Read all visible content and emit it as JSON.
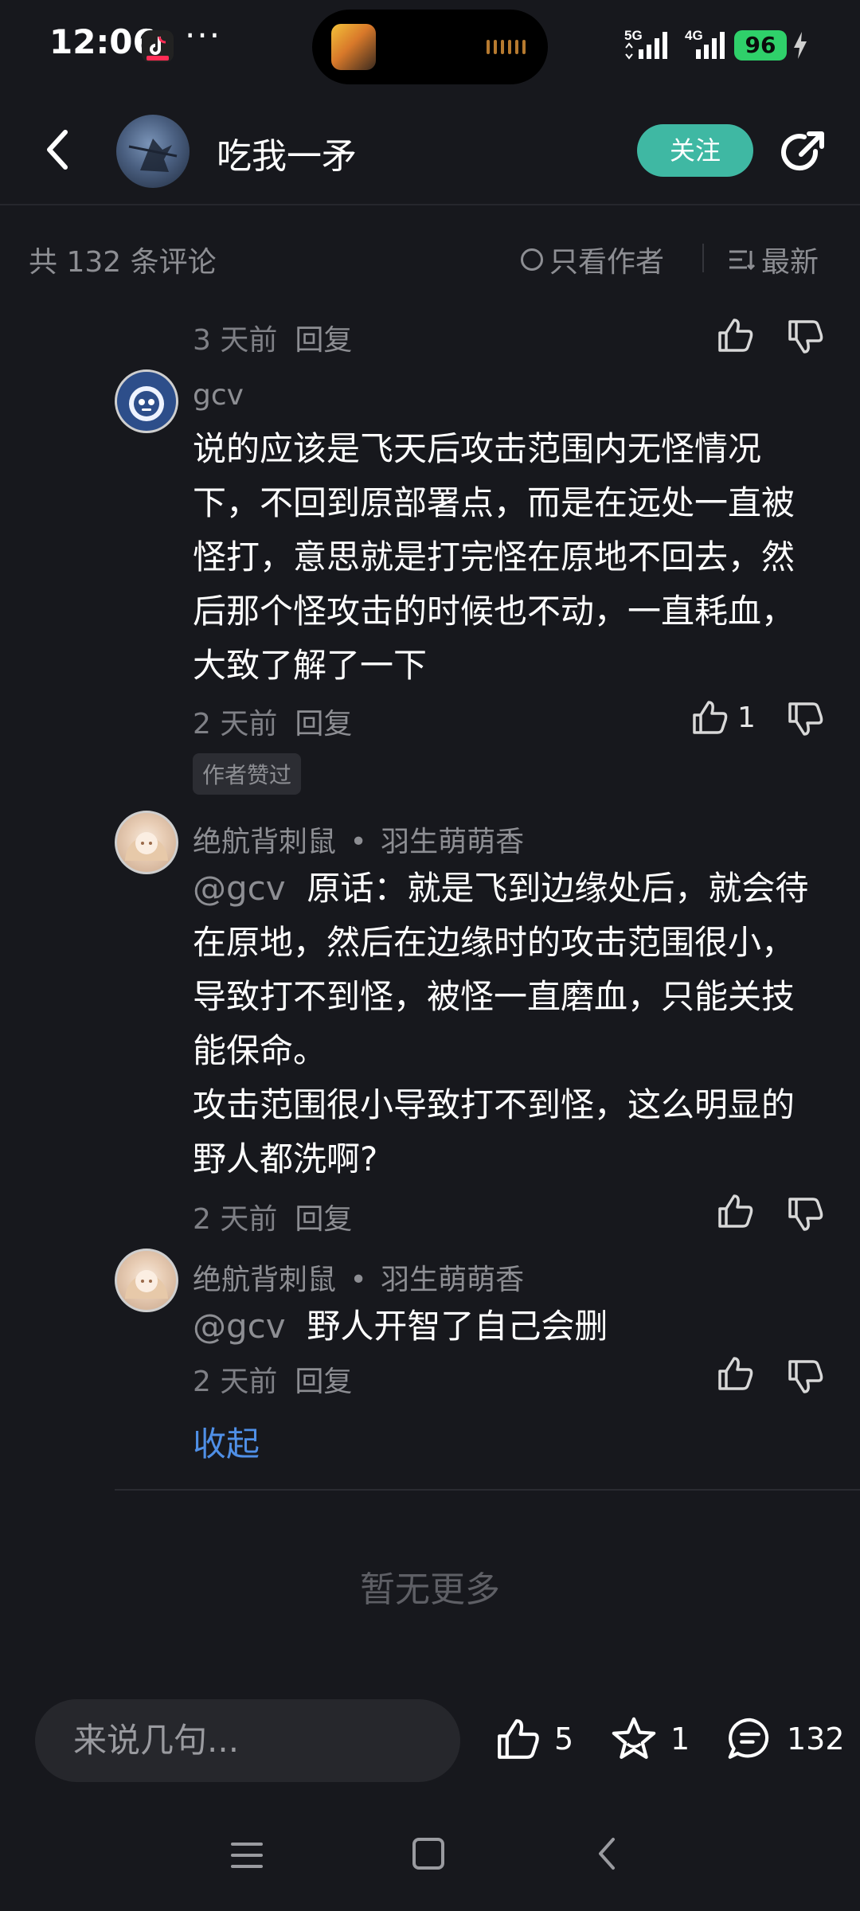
{
  "status_bar": {
    "time": "12:06",
    "more": "···",
    "net1": "5G",
    "net2": "4G",
    "battery": "96"
  },
  "header": {
    "author_name": "吃我一矛",
    "follow_label": "关注",
    "icons": [
      "back-icon",
      "share-icon"
    ]
  },
  "filters": {
    "comment_count": "共 132 条评论",
    "only_author": "只看作者",
    "sort_label": "最新"
  },
  "comments": [
    {
      "time": "3 天前",
      "reply_label": "回复"
    },
    {
      "user": "gcv",
      "text": "说的应该是飞天后攻击范围内无怪情况下，不回到原部署点，而是在远处一直被怪打，意思就是打完怪在原地不回去，然后那个怪攻击的时候也不动，一直耗血，大致了解了一下",
      "time": "2 天前",
      "reply_label": "回复",
      "likes": "1",
      "badge": "作者赞过"
    },
    {
      "user": "绝航背刺鼠",
      "reply_to": "羽生萌萌香",
      "mention": "@gcv",
      "text": "原话：就是飞到边缘处后，就会待在原地，然后在边缘时的攻击范围很小，导致打不到怪，被怪一直磨血，只能关技能保命。",
      "text2": "攻击范围很小导致打不到怪，这么明显的野人都洗啊?",
      "time": "2 天前",
      "reply_label": "回复"
    },
    {
      "user": "绝航背刺鼠",
      "reply_to": "羽生萌萌香",
      "mention": "@gcv",
      "text": "野人开智了自己会删",
      "time": "2 天前",
      "reply_label": "回复"
    }
  ],
  "collapse_label": "收起",
  "no_more": "暂无更多",
  "bottom_bar": {
    "input_placeholder": "来说几句...",
    "likes": "5",
    "favorites": "1",
    "comments": "132"
  }
}
